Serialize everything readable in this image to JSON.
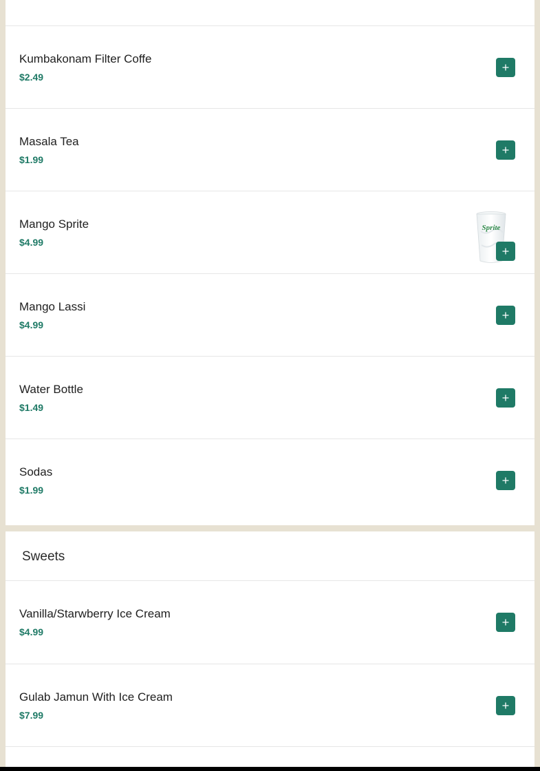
{
  "drinks": {
    "items": [
      {
        "name": "Kumbakonam Filter Coffe",
        "price": "$2.49"
      },
      {
        "name": "Masala Tea",
        "price": "$1.99"
      },
      {
        "name": "Mango Sprite",
        "price": "$4.99",
        "image_label": "Sprite"
      },
      {
        "name": "Mango Lassi",
        "price": "$4.99"
      },
      {
        "name": "Water Bottle",
        "price": "$1.49"
      },
      {
        "name": "Sodas",
        "price": "$1.99"
      }
    ]
  },
  "sweets": {
    "title": "Sweets",
    "items": [
      {
        "name": "Vanilla/Starwberry Ice Cream",
        "price": "$4.99"
      },
      {
        "name": "Gulab Jamun With Ice Cream",
        "price": "$7.99"
      }
    ]
  },
  "colors": {
    "accent": "#1f7a66",
    "background": "#e7e1d2",
    "card": "#ffffff"
  },
  "icons": {
    "add": "plus-icon"
  }
}
